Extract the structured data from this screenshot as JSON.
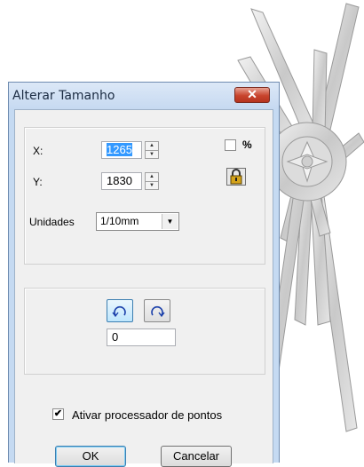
{
  "dialog": {
    "title": "Alterar Tamanho",
    "close_icon": "close-icon"
  },
  "size": {
    "x_label": "X:",
    "x_value": "1265",
    "y_label": "Y:",
    "y_value": "1830",
    "percent_label": "%",
    "percent_checked": false,
    "lock_icon": "lock-icon"
  },
  "units": {
    "label": "Unidades",
    "selected": "1/10mm"
  },
  "rotation": {
    "ccw_icon": "rotate-counterclockwise-icon",
    "cw_icon": "rotate-clockwise-icon",
    "angle_value": "0"
  },
  "processor": {
    "label": "Ativar processador de pontos",
    "checked": true
  },
  "buttons": {
    "ok": "OK",
    "cancel": "Cancelar"
  },
  "colors": {
    "title_bar": "#c6d9f1",
    "close_red": "#c8432c",
    "selection": "#3399ff"
  }
}
